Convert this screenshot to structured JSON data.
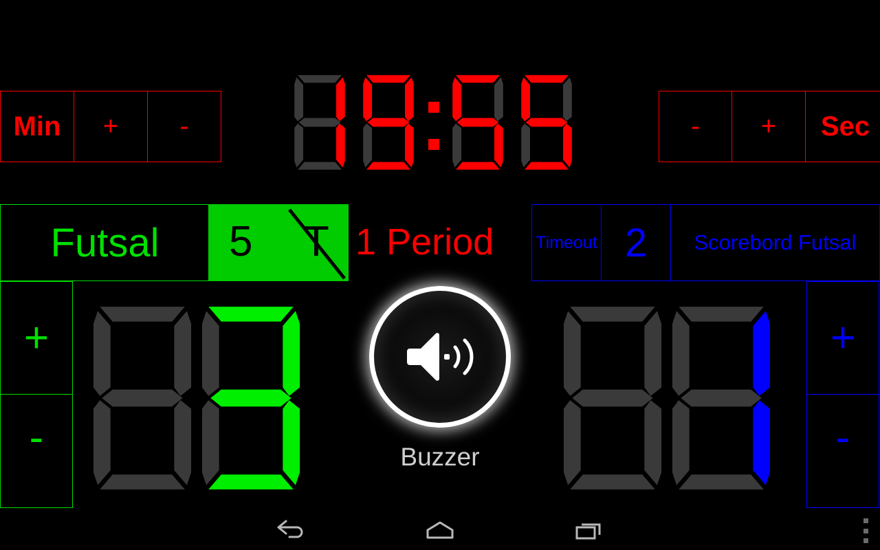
{
  "app": {
    "title": "Scorebord Futsal",
    "sport_label": "Futsal",
    "period_label": "1 Period"
  },
  "clock": {
    "minutes": "19",
    "seconds": "55",
    "separator": ":",
    "color": "#ff0000",
    "off_color": "#3a3a3a"
  },
  "min_controls": {
    "label": "Min",
    "plus": "+",
    "minus": "-",
    "color": "#ff0000"
  },
  "sec_controls": {
    "minus": "-",
    "plus": "+",
    "label": "Sec",
    "color": "#ff0000"
  },
  "foul_block": {
    "count": "5",
    "timeout_marker": "T",
    "struck_through": true,
    "background": "#00cc00",
    "text_color": "#000000"
  },
  "timeout": {
    "label": "Timeout",
    "count": "2",
    "title": "Scorebord Futsal",
    "color": "#0000ff"
  },
  "home": {
    "score": "3",
    "score_digits": "_3",
    "plus": "+",
    "minus": "-",
    "color": "#00ee00"
  },
  "away": {
    "score": "1",
    "score_digits": "_1",
    "plus": "+",
    "minus": "-",
    "color": "#0000ff"
  },
  "buzzer": {
    "label": "Buzzer",
    "icon": "speaker-icon",
    "color": "#ffffff"
  },
  "navbar": {
    "back": "back-icon",
    "home": "home-icon",
    "recents": "recents-icon",
    "overflow": "overflow-menu-icon"
  }
}
